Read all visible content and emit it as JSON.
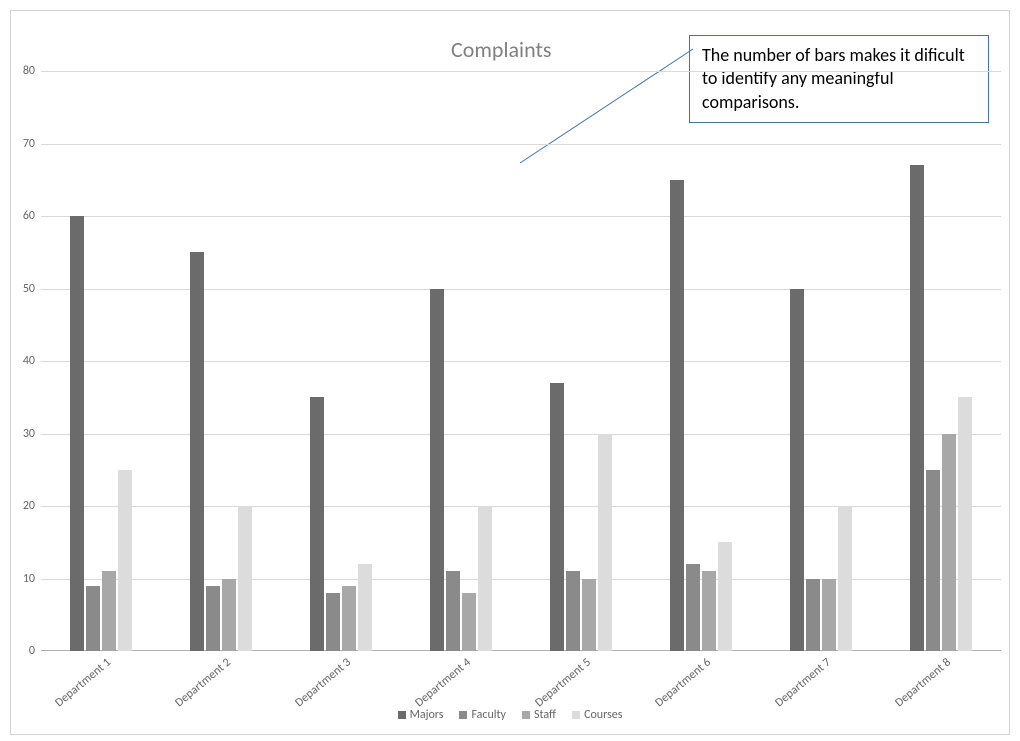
{
  "chart_data": {
    "type": "bar",
    "title": "Complaints",
    "ylim": [
      0,
      80
    ],
    "yticks": [
      0,
      10,
      20,
      30,
      40,
      50,
      60,
      70,
      80
    ],
    "categories": [
      "Department 1",
      "Department 2",
      "Department 3",
      "Department 4",
      "Department 5",
      "Department 6",
      "Department 7",
      "Department 8"
    ],
    "series": [
      {
        "name": "Majors",
        "values": [
          60,
          55,
          35,
          50,
          37,
          65,
          50,
          67
        ]
      },
      {
        "name": "Faculty",
        "values": [
          9,
          9,
          8,
          11,
          11,
          12,
          10,
          25
        ]
      },
      {
        "name": "Staff",
        "values": [
          11,
          10,
          9,
          8,
          10,
          11,
          10,
          30
        ]
      },
      {
        "name": "Courses",
        "values": [
          25,
          20,
          12,
          20,
          30,
          15,
          20,
          35
        ]
      }
    ],
    "legend_labels": [
      "Majors",
      "Faculty",
      "Staff",
      "Courses"
    ]
  },
  "annotation": "The number of bars makes it dificult to identify any meaningful comparisons."
}
